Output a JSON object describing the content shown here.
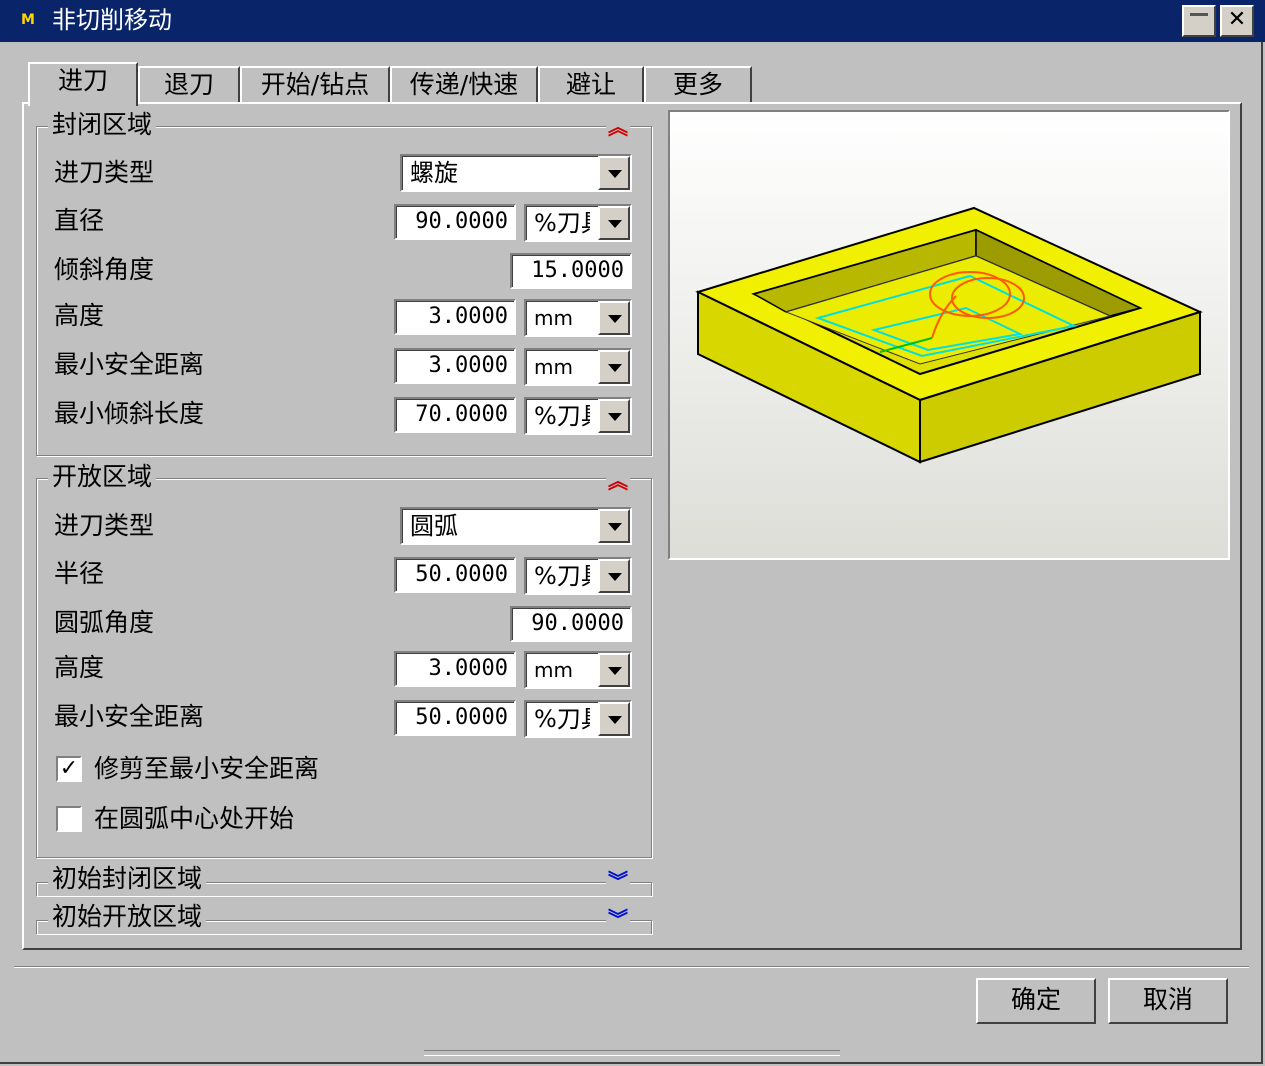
{
  "window": {
    "title": "非切削移动",
    "icon": "app-icon"
  },
  "tabs": [
    {
      "label": "进刀",
      "active": true
    },
    {
      "label": "退刀"
    },
    {
      "label": "开始/钻点"
    },
    {
      "label": "传递/快速"
    },
    {
      "label": "避让"
    },
    {
      "label": "更多"
    }
  ],
  "closed_area": {
    "title": "封闭区域",
    "entry_type_label": "进刀类型",
    "entry_type": "螺旋",
    "diameter_label": "直径",
    "diameter": "90.0000",
    "diameter_unit": "%刀具",
    "ramp_angle_label": "倾斜角度",
    "ramp_angle": "15.0000",
    "height_label": "高度",
    "height": "3.0000",
    "height_unit": "mm",
    "min_clearance_label": "最小安全距离",
    "min_clearance": "3.0000",
    "min_clearance_unit": "mm",
    "min_ramp_length_label": "最小倾斜长度",
    "min_ramp_length": "70.0000",
    "min_ramp_length_unit": "%刀具"
  },
  "open_area": {
    "title": "开放区域",
    "entry_type_label": "进刀类型",
    "entry_type": "圆弧",
    "radius_label": "半径",
    "radius": "50.0000",
    "radius_unit": "%刀具",
    "arc_angle_label": "圆弧角度",
    "arc_angle": "90.0000",
    "height_label": "高度",
    "height": "3.0000",
    "height_unit": "mm",
    "min_clearance_label": "最小安全距离",
    "min_clearance": "50.0000",
    "min_clearance_unit": "%刀具",
    "trim_label": "修剪至最小安全距离",
    "trim_checked": true,
    "start_center_label": "在圆弧中心处开始",
    "start_center_checked": false
  },
  "initial_closed_area": {
    "title": "初始封闭区域"
  },
  "initial_open_area": {
    "title": "初始开放区域"
  },
  "buttons": {
    "ok": "确定",
    "cancel": "取消"
  },
  "colors": {
    "titlebar": "#0a246a",
    "part": "#e6e600",
    "toolpath_cyan": "#00e0e0",
    "toolpath_orange": "#ff5a00",
    "toolpath_green": "#00c000"
  }
}
